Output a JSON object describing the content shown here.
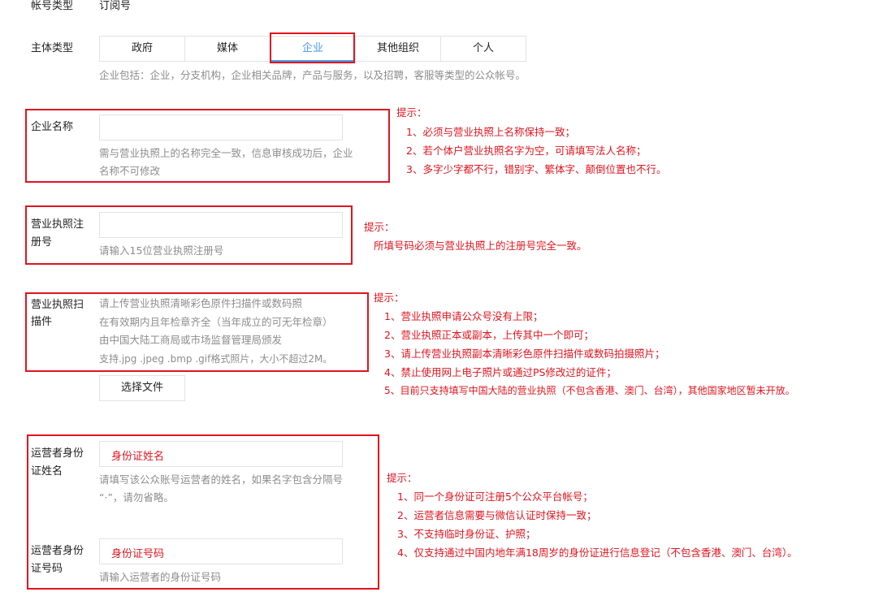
{
  "account_type": {
    "label": "帐号类型",
    "value": "订阅号"
  },
  "entity_type": {
    "label": "主体类型",
    "options": [
      "政府",
      "媒体",
      "企业",
      "其他组织",
      "个人"
    ],
    "selected": "企业",
    "hint": "企业包括：企业，分支机构，企业相关品牌，产品与服务，以及招聘，客服等类型的公众帐号。"
  },
  "company_name": {
    "label": "企业名称",
    "hint_line1": "需与营业执照上的名称完全一致，信息审核成功后，企业",
    "hint_line2": "名称不可修改",
    "tip_title": "提示：",
    "tips": [
      "1、必须与营业执照上名称保持一致；",
      "2、若个体户营业执照名字为空，可请填写法人名称；",
      "3、多字少字都不行，错别字、繁体字、颠倒位置也不行。"
    ]
  },
  "license_number": {
    "label_line1": "营业执照注",
    "label_line2": "册号",
    "hint": "请输入15位营业执照注册号",
    "tip_title": "提示：",
    "tip": "所填号码必须与营业执照上的注册号完全一致。"
  },
  "license_scan": {
    "label_line1": "营业执照扫",
    "label_line2": "描件",
    "hints": [
      "请上传营业执照清晰彩色原件扫描件或数码照",
      "在有效期内且年检章齐全（当年成立的可无年检章）",
      "由中国大陆工商局或市场监督管理局颁发",
      "支持.jpg .jpeg .bmp .gif格式照片，大小不超过2M。"
    ],
    "button": "选择文件",
    "tip_title": "提示：",
    "tips": [
      "1、营业执照申请公众号没有上限；",
      "2、营业执照正本或副本，上传其中一个即可；",
      "3、请上传营业执照副本清晰彩色原件扫描件或数码拍摄照片；",
      "4、禁止使用网上电子照片或通过PS修改过的证件；",
      "5、目前只支持填写中国大陆的营业执照（不包含香港、澳门、台湾），其他国家地区暂未开放。"
    ]
  },
  "operator": {
    "name_label_line1": "运营者身份",
    "name_label_line2": "证姓名",
    "name_value": "身份证姓名",
    "name_hint_line1": "请填写该公众账号运营者的姓名，如果名字包含分隔号",
    "name_hint_line2": "“·”，请勿省略。",
    "id_label_line1": "运营者身份",
    "id_label_line2": "证号码",
    "id_value": "身份证号码",
    "id_hint": "请输入运营者的身份证号码",
    "tip_title": "提示：",
    "tips": [
      "1、同一个身份证可注册5个公众平台帐号；",
      "2、运营者信息需要与微信认证时保持一致；",
      "3、不支持临时身份证、护照；",
      "4、仅支持通过中国内地年满18周岁的身份证进行信息登记（不包含香港、澳门、台湾）。"
    ]
  },
  "colors": {
    "highlight": "#e0141e",
    "accent": "#459ae9",
    "hint": "#8d8d8d"
  }
}
